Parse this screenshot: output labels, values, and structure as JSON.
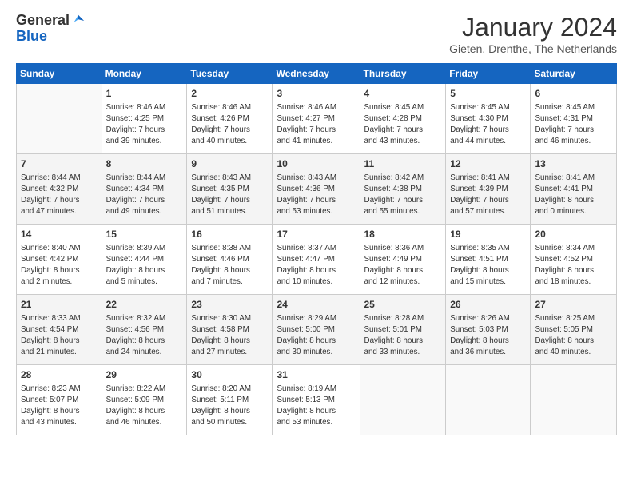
{
  "logo": {
    "general": "General",
    "blue": "Blue"
  },
  "header": {
    "month": "January 2024",
    "location": "Gieten, Drenthe, The Netherlands"
  },
  "days_of_week": [
    "Sunday",
    "Monday",
    "Tuesday",
    "Wednesday",
    "Thursday",
    "Friday",
    "Saturday"
  ],
  "weeks": [
    [
      {
        "day": "",
        "info": ""
      },
      {
        "day": "1",
        "info": "Sunrise: 8:46 AM\nSunset: 4:25 PM\nDaylight: 7 hours\nand 39 minutes."
      },
      {
        "day": "2",
        "info": "Sunrise: 8:46 AM\nSunset: 4:26 PM\nDaylight: 7 hours\nand 40 minutes."
      },
      {
        "day": "3",
        "info": "Sunrise: 8:46 AM\nSunset: 4:27 PM\nDaylight: 7 hours\nand 41 minutes."
      },
      {
        "day": "4",
        "info": "Sunrise: 8:45 AM\nSunset: 4:28 PM\nDaylight: 7 hours\nand 43 minutes."
      },
      {
        "day": "5",
        "info": "Sunrise: 8:45 AM\nSunset: 4:30 PM\nDaylight: 7 hours\nand 44 minutes."
      },
      {
        "day": "6",
        "info": "Sunrise: 8:45 AM\nSunset: 4:31 PM\nDaylight: 7 hours\nand 46 minutes."
      }
    ],
    [
      {
        "day": "7",
        "info": "Sunrise: 8:44 AM\nSunset: 4:32 PM\nDaylight: 7 hours\nand 47 minutes."
      },
      {
        "day": "8",
        "info": "Sunrise: 8:44 AM\nSunset: 4:34 PM\nDaylight: 7 hours\nand 49 minutes."
      },
      {
        "day": "9",
        "info": "Sunrise: 8:43 AM\nSunset: 4:35 PM\nDaylight: 7 hours\nand 51 minutes."
      },
      {
        "day": "10",
        "info": "Sunrise: 8:43 AM\nSunset: 4:36 PM\nDaylight: 7 hours\nand 53 minutes."
      },
      {
        "day": "11",
        "info": "Sunrise: 8:42 AM\nSunset: 4:38 PM\nDaylight: 7 hours\nand 55 minutes."
      },
      {
        "day": "12",
        "info": "Sunrise: 8:41 AM\nSunset: 4:39 PM\nDaylight: 7 hours\nand 57 minutes."
      },
      {
        "day": "13",
        "info": "Sunrise: 8:41 AM\nSunset: 4:41 PM\nDaylight: 8 hours\nand 0 minutes."
      }
    ],
    [
      {
        "day": "14",
        "info": "Sunrise: 8:40 AM\nSunset: 4:42 PM\nDaylight: 8 hours\nand 2 minutes."
      },
      {
        "day": "15",
        "info": "Sunrise: 8:39 AM\nSunset: 4:44 PM\nDaylight: 8 hours\nand 5 minutes."
      },
      {
        "day": "16",
        "info": "Sunrise: 8:38 AM\nSunset: 4:46 PM\nDaylight: 8 hours\nand 7 minutes."
      },
      {
        "day": "17",
        "info": "Sunrise: 8:37 AM\nSunset: 4:47 PM\nDaylight: 8 hours\nand 10 minutes."
      },
      {
        "day": "18",
        "info": "Sunrise: 8:36 AM\nSunset: 4:49 PM\nDaylight: 8 hours\nand 12 minutes."
      },
      {
        "day": "19",
        "info": "Sunrise: 8:35 AM\nSunset: 4:51 PM\nDaylight: 8 hours\nand 15 minutes."
      },
      {
        "day": "20",
        "info": "Sunrise: 8:34 AM\nSunset: 4:52 PM\nDaylight: 8 hours\nand 18 minutes."
      }
    ],
    [
      {
        "day": "21",
        "info": "Sunrise: 8:33 AM\nSunset: 4:54 PM\nDaylight: 8 hours\nand 21 minutes."
      },
      {
        "day": "22",
        "info": "Sunrise: 8:32 AM\nSunset: 4:56 PM\nDaylight: 8 hours\nand 24 minutes."
      },
      {
        "day": "23",
        "info": "Sunrise: 8:30 AM\nSunset: 4:58 PM\nDaylight: 8 hours\nand 27 minutes."
      },
      {
        "day": "24",
        "info": "Sunrise: 8:29 AM\nSunset: 5:00 PM\nDaylight: 8 hours\nand 30 minutes."
      },
      {
        "day": "25",
        "info": "Sunrise: 8:28 AM\nSunset: 5:01 PM\nDaylight: 8 hours\nand 33 minutes."
      },
      {
        "day": "26",
        "info": "Sunrise: 8:26 AM\nSunset: 5:03 PM\nDaylight: 8 hours\nand 36 minutes."
      },
      {
        "day": "27",
        "info": "Sunrise: 8:25 AM\nSunset: 5:05 PM\nDaylight: 8 hours\nand 40 minutes."
      }
    ],
    [
      {
        "day": "28",
        "info": "Sunrise: 8:23 AM\nSunset: 5:07 PM\nDaylight: 8 hours\nand 43 minutes."
      },
      {
        "day": "29",
        "info": "Sunrise: 8:22 AM\nSunset: 5:09 PM\nDaylight: 8 hours\nand 46 minutes."
      },
      {
        "day": "30",
        "info": "Sunrise: 8:20 AM\nSunset: 5:11 PM\nDaylight: 8 hours\nand 50 minutes."
      },
      {
        "day": "31",
        "info": "Sunrise: 8:19 AM\nSunset: 5:13 PM\nDaylight: 8 hours\nand 53 minutes."
      },
      {
        "day": "",
        "info": ""
      },
      {
        "day": "",
        "info": ""
      },
      {
        "day": "",
        "info": ""
      }
    ]
  ]
}
